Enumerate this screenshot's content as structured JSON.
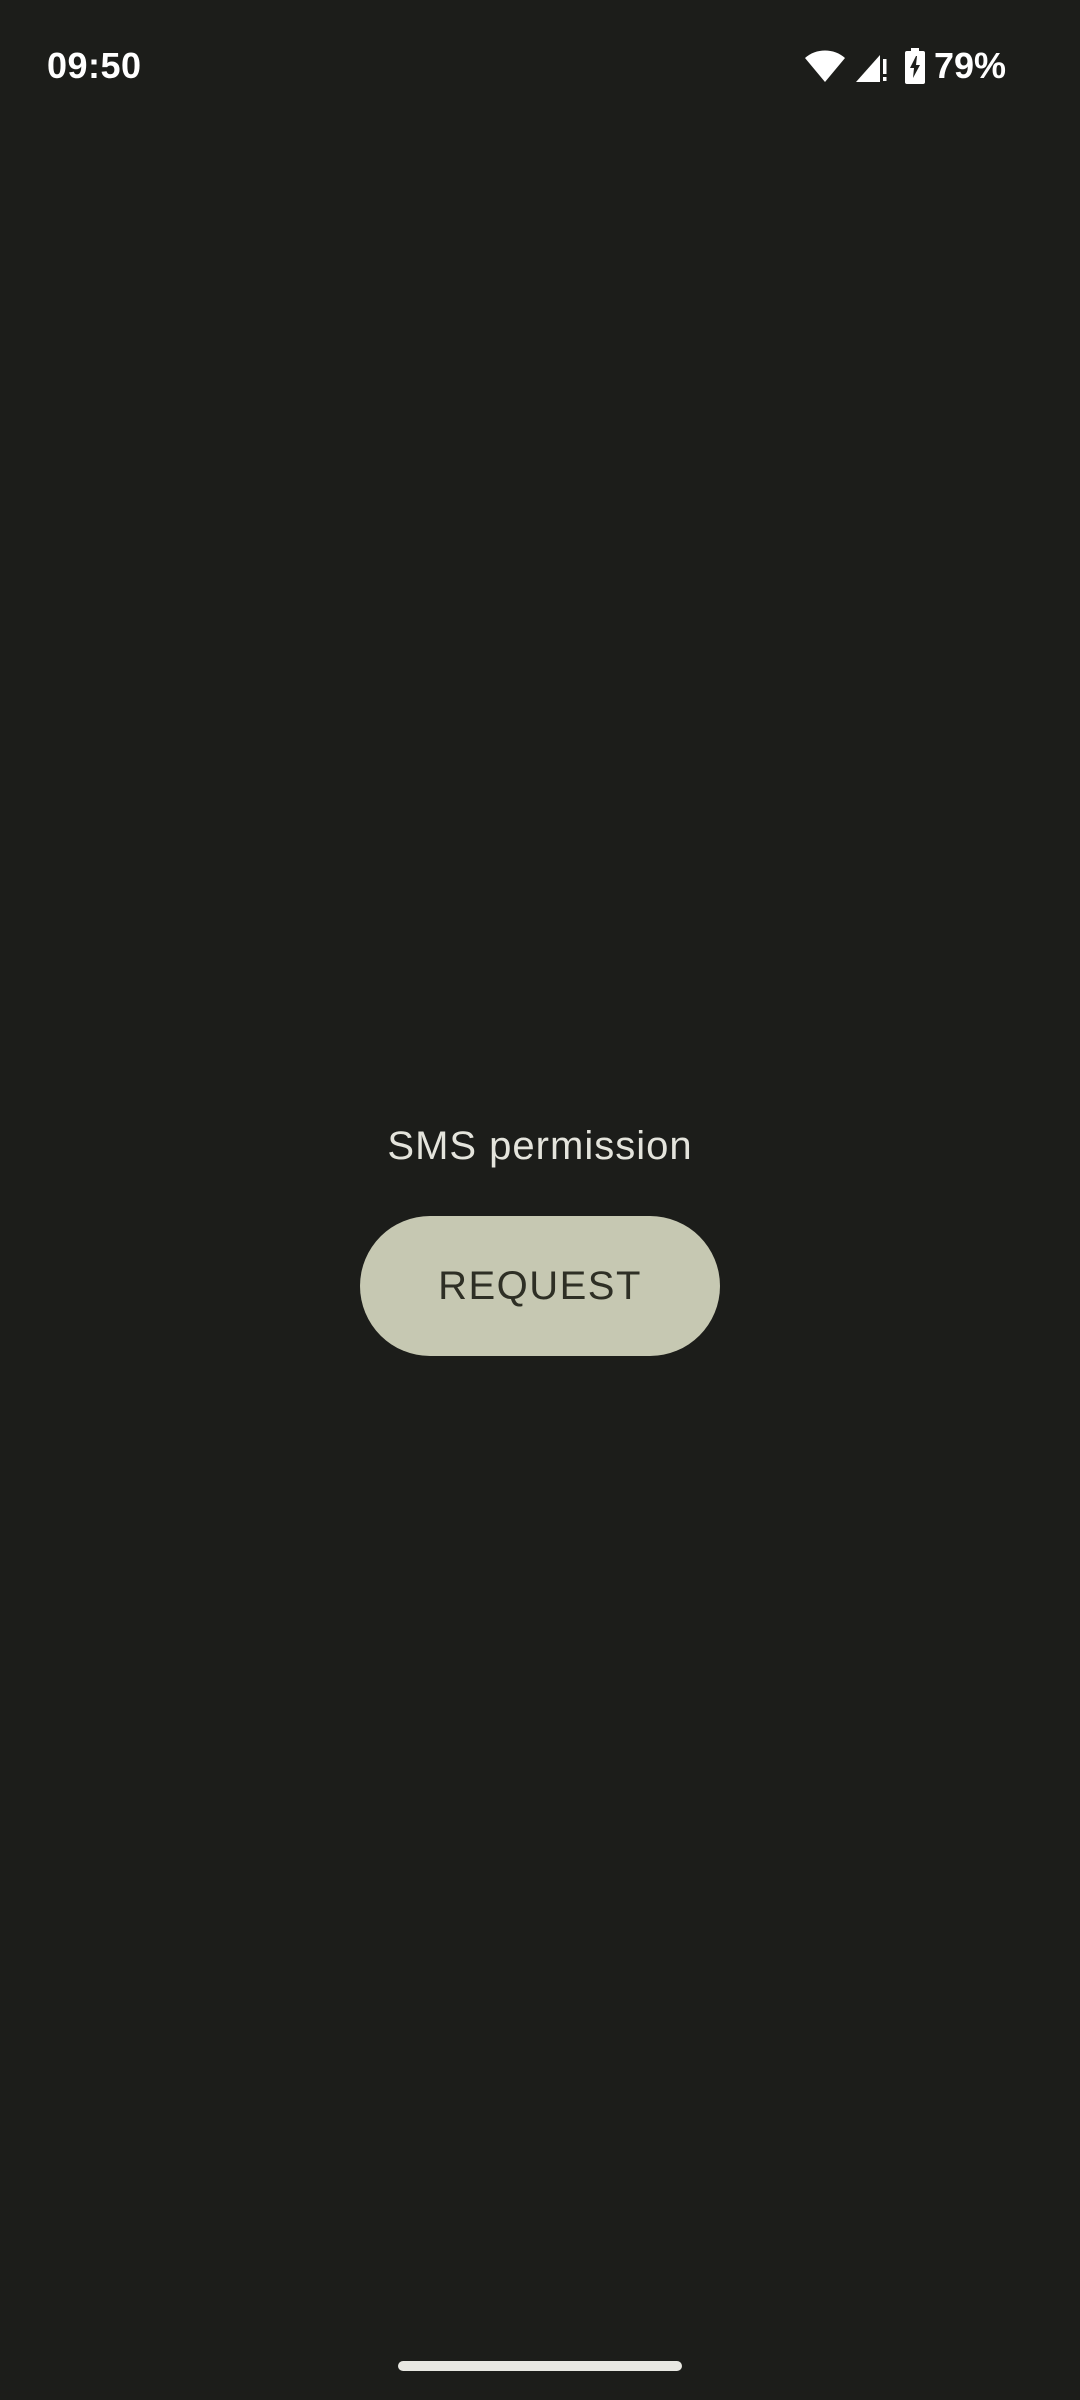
{
  "status_bar": {
    "time": "09:50",
    "battery_percent": "79%",
    "icons": [
      "wifi-icon",
      "signal-icon",
      "battery-charging-icon"
    ]
  },
  "main": {
    "label": "SMS permission",
    "request_button_label": "REQUEST"
  },
  "colors": {
    "background": "#1c1d1a",
    "button_background": "#c6c8b2",
    "button_text": "#2e2f25",
    "label_text": "#e4e4dc"
  }
}
